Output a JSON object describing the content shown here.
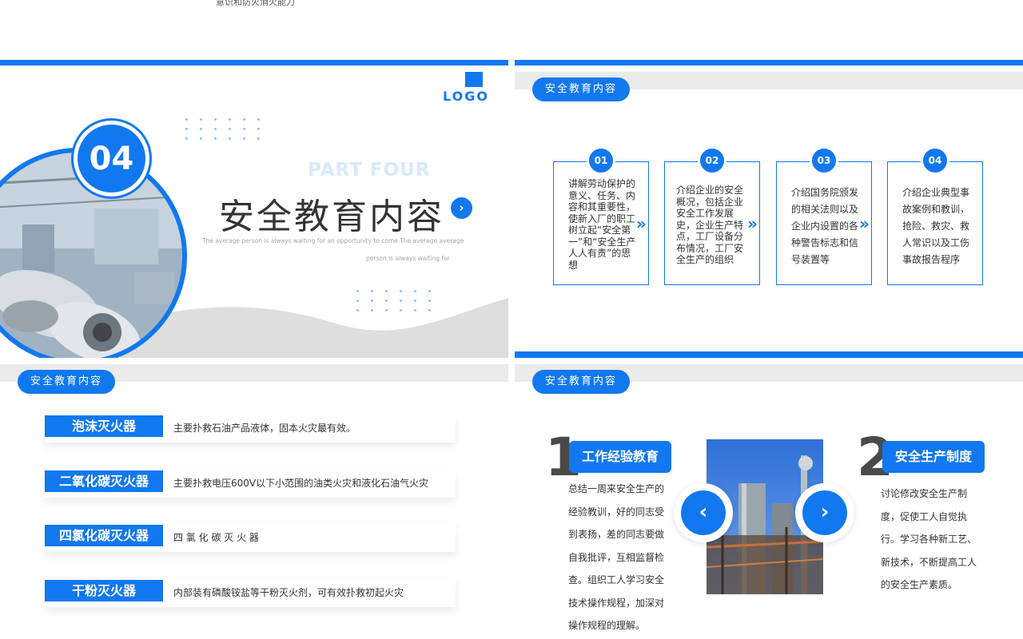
{
  "top_strip": {
    "fragment": "意识和防火消火能力"
  },
  "cover": {
    "logo": "LOGO",
    "number": "04",
    "part_label": "PART FOUR",
    "title": "安全教育内容",
    "arrow": "›",
    "subtitle_line1": "The average person is always waiting for an opportunity to come The average average",
    "subtitle_line2": "person is always waiting for",
    "accent": "#1278ef"
  },
  "content_slide": {
    "section": "安全教育内容",
    "cards": [
      {
        "num": "01",
        "text": "讲解劳动保护的意义、任务、内容和其重要性，使新入厂的职工树立起“安全第一”和“安全生产人人有责”的思想"
      },
      {
        "num": "02",
        "text": "介绍企业的安全概况，包括企业安全工作发展史，企业生产特点，工厂设备分布情况，工厂安全生产的组织"
      },
      {
        "num": "03",
        "text": "介绍国务院颁发的相关法则以及企业内设置的各种警告标志和信号装置等"
      },
      {
        "num": "04",
        "text": "介绍企业典型事故案例和教训，抢险、救灾、救人常识以及工伤事故报告程序"
      }
    ],
    "chevron": "»"
  },
  "fire_slide": {
    "section": "安全教育内容",
    "extinguishers": [
      {
        "name": "泡沫灭火器",
        "desc": "主要扑救石油产品液体，固本火灾最有效。"
      },
      {
        "name": "二氧化碳灭火器",
        "desc": "主要扑救电压600V以下小范围的油类火灾和液化石油气火灾"
      },
      {
        "name": "四氯化碳灭火器",
        "desc": "四 氯 化 碳 灭 火 器"
      },
      {
        "name": "干粉灭火器",
        "desc": "内部装有磷酸铵盐等干粉灭火剂，可有效扑救初起火灾"
      }
    ]
  },
  "edu_slide": {
    "section": "安全教育内容",
    "left": {
      "num": "1",
      "title": "工作经验教育",
      "text": "总结一周来安全生产的经验教训，好的同志受到表扬，差的同志要做自我批评，互相监督检查。组织工人学习安全技术操作规程，加深对操作规程的理解。"
    },
    "right": {
      "num": "2",
      "title": "安全生产制度",
      "text": "讨论修改安全生产制度，促使工人自觉执行。学习各种新工艺、新技术，不断提高工人的安全生产素质。"
    },
    "prev_icon": "‹",
    "next_icon": "›"
  }
}
